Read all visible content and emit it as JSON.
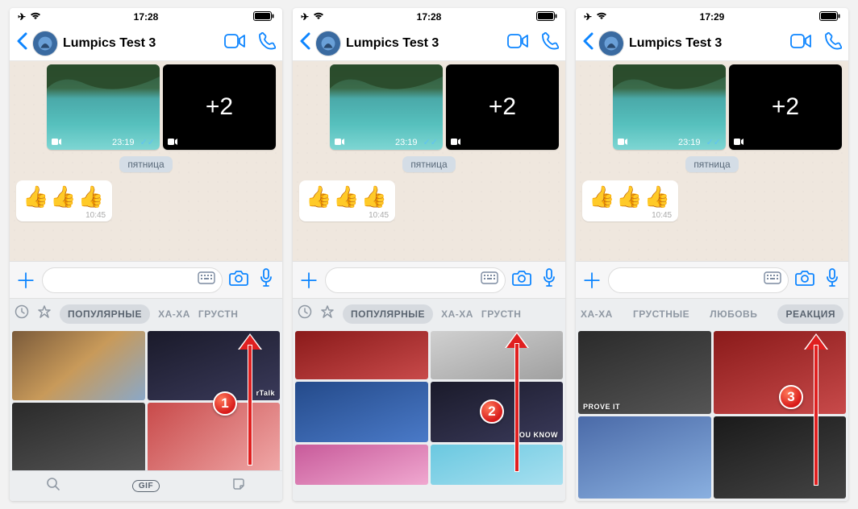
{
  "screens": [
    {
      "status_time": "17:28",
      "contact": "Lumpics Test 3",
      "media_extra": "+2",
      "media_time": "23:19",
      "day_label": "пятница",
      "msg_emoji": "👍👍👍",
      "msg_time": "10:45",
      "categories": {
        "show_icons": true,
        "tabs": [
          "ПОПУЛЯРНЫЕ",
          "ХА-ХА",
          "ГРУСТН"
        ],
        "active_index": 0
      },
      "gif_pill": "GIF",
      "step": "1",
      "captions": {
        "c1": "rTalk"
      }
    },
    {
      "status_time": "17:28",
      "contact": "Lumpics Test 3",
      "media_extra": "+2",
      "media_time": "23:19",
      "day_label": "пятница",
      "msg_emoji": "👍👍👍",
      "msg_time": "10:45",
      "categories": {
        "show_icons": true,
        "tabs": [
          "ПОПУЛЯРНЫЕ",
          "ХА-ХА",
          "ГРУСТН"
        ],
        "active_index": 0
      },
      "step": "2",
      "captions": {
        "c2": "YOU KNOW"
      }
    },
    {
      "status_time": "17:29",
      "contact": "Lumpics Test 3",
      "media_extra": "+2",
      "media_time": "23:19",
      "day_label": "пятница",
      "msg_emoji": "👍👍👍",
      "msg_time": "10:45",
      "categories": {
        "show_icons": false,
        "tabs": [
          "ХА-ХА",
          "ГРУСТНЫЕ",
          "ЛЮБОВЬ",
          "РЕАКЦИЯ"
        ],
        "active_index": 3
      },
      "step": "3",
      "captions": {
        "c3": "PROVE IT"
      }
    }
  ]
}
